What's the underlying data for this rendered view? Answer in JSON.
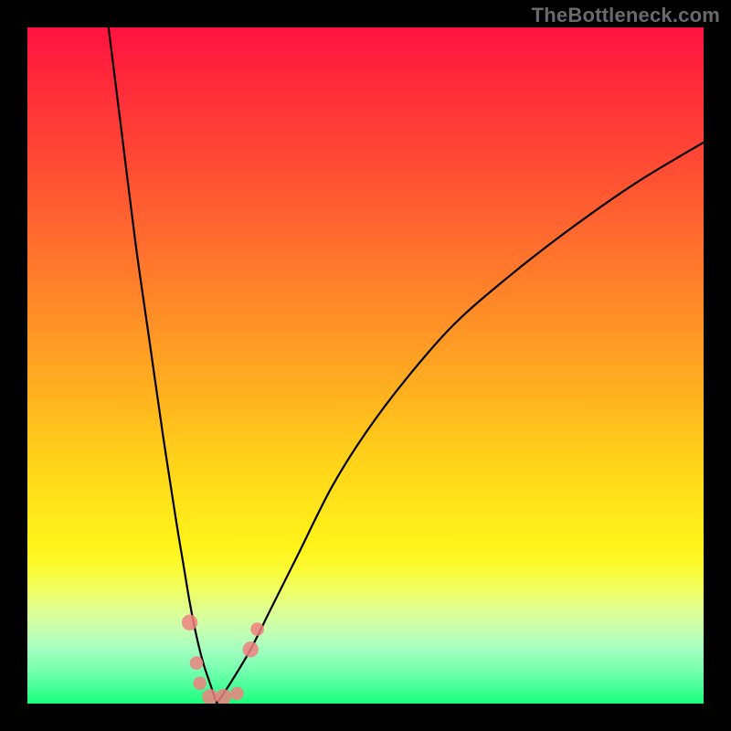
{
  "watermark": "TheBottleneck.com",
  "colors": {
    "background_border": "#000000",
    "gradient_top": "#ff1240",
    "gradient_mid": "#ffd21a",
    "gradient_bottom": "#18ff7c",
    "curve_stroke": "#000000",
    "marker_fill": "#f08080"
  },
  "chart_data": {
    "type": "line",
    "title": "",
    "xlabel": "",
    "ylabel": "",
    "xlim": [
      0,
      100
    ],
    "ylim": [
      0,
      100
    ],
    "grid": false,
    "legend": false,
    "annotations": [],
    "series": [
      {
        "name": "left-curve",
        "x": [
          12,
          14,
          16,
          18,
          20,
          22,
          23,
          24,
          25,
          26,
          27,
          28
        ],
        "y": [
          100,
          84,
          68,
          54,
          40,
          27,
          21,
          15,
          10,
          6,
          3,
          0
        ]
      },
      {
        "name": "right-curve",
        "x": [
          28,
          30,
          33,
          36,
          40,
          45,
          50,
          56,
          63,
          71,
          80,
          90,
          100
        ],
        "y": [
          0,
          3,
          8,
          14,
          22,
          32,
          40,
          48,
          56,
          63,
          70,
          77,
          83
        ]
      }
    ],
    "markers": [
      {
        "x": 24.0,
        "y": 12.0,
        "r": 1.3
      },
      {
        "x": 25.0,
        "y": 6.0,
        "r": 1.1
      },
      {
        "x": 25.5,
        "y": 3.0,
        "r": 1.1
      },
      {
        "x": 27.0,
        "y": 1.0,
        "r": 1.3
      },
      {
        "x": 29.0,
        "y": 1.0,
        "r": 1.3
      },
      {
        "x": 31.0,
        "y": 1.5,
        "r": 1.1
      },
      {
        "x": 33.0,
        "y": 8.0,
        "r": 1.3
      },
      {
        "x": 34.0,
        "y": 11.0,
        "r": 1.1
      }
    ]
  }
}
